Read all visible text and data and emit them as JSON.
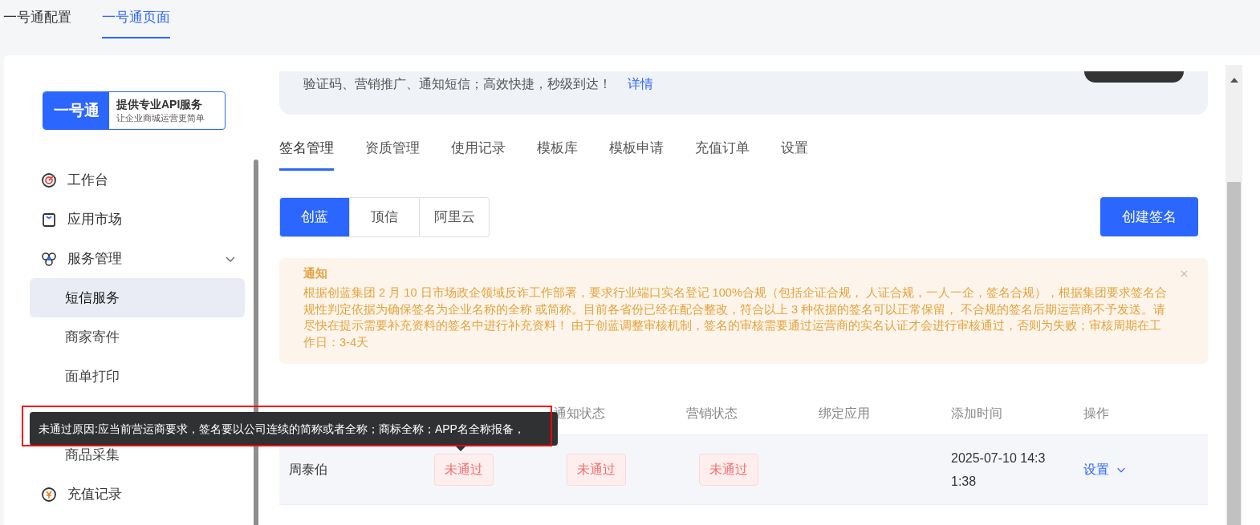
{
  "top_tabs": [
    {
      "label": "一号通配置",
      "selected": false
    },
    {
      "label": "一号通页面",
      "selected": true
    }
  ],
  "sidebar": {
    "logo": {
      "mark": "一号通",
      "title": "提供专业API服务",
      "subtitle": "让企业商城运营更简单"
    },
    "items": [
      {
        "kind": "item",
        "label": "工作台"
      },
      {
        "kind": "item",
        "label": "应用市场"
      },
      {
        "kind": "group",
        "label": "服务管理",
        "expanded": true
      },
      {
        "kind": "sub",
        "label": "短信服务",
        "selected": true
      },
      {
        "kind": "sub",
        "label": "商家寄件",
        "selected": false
      },
      {
        "kind": "sub",
        "label": "面单打印",
        "selected": false
      },
      {
        "kind": "sub"
      },
      {
        "kind": "sub",
        "label": "商品采集",
        "selected": false
      },
      {
        "kind": "item",
        "label": "充值记录"
      }
    ]
  },
  "banner": {
    "text": "验证码、营销推广、通知短信；高效快捷，秒级到达！",
    "link": "详情"
  },
  "tabs": [
    {
      "label": "签名管理",
      "selected": true
    },
    {
      "label": "资质管理",
      "selected": false
    },
    {
      "label": "使用记录",
      "selected": false
    },
    {
      "label": "模板库",
      "selected": false
    },
    {
      "label": "模板申请",
      "selected": false
    },
    {
      "label": "充值订单",
      "selected": false
    },
    {
      "label": "设置",
      "selected": false
    }
  ],
  "providers": [
    {
      "label": "创蓝",
      "selected": true
    },
    {
      "label": "顶信",
      "selected": false
    },
    {
      "label": "阿里云",
      "selected": false
    }
  ],
  "create_button": "创建签名",
  "notice": {
    "title": "通知",
    "text": "根据创蓝集团 2 月 10 日市场政企领域反诈工作部署，要求行业端口实名登记 100%合规（包括企证合规， 人证合规，一人一企，签名合规），根据集团要求签名合规性判定依据为确保签名为企业名称的全称 或简称。目前各省份已经在配合整改，符合以上 3 种依据的签名可以正常保留， 不合规的签名后期运营商不予发送。请尽快在提示需要补充资料的签名中进行补充资料！ 由于创蓝调整审核机制，签名的审核需要通过运营商的实名认证才会进行审核通过，否则为失败；审核周期在工作日：3-4天"
  },
  "table": {
    "columns": [
      {},
      {},
      {
        "label": "通知状态"
      },
      {
        "label": "营销状态"
      },
      {
        "label": "绑定应用"
      },
      {
        "label": "添加时间"
      },
      {
        "label": "操作"
      }
    ],
    "rows": [
      {
        "signature": "周泰伯",
        "statuses": [
          {
            "text": "未通过",
            "kind": "fail"
          },
          {
            "text": "未通过",
            "kind": "fail"
          },
          {
            "text": "未通过",
            "kind": "fail"
          }
        ],
        "time": "2025-07-10 14:31:38",
        "action": "设置"
      }
    ]
  },
  "tooltip": "未通过原因:应当前营运商要求，签名要以公司连续的简称或者全称；商标全称；APP名全称报备，"
}
